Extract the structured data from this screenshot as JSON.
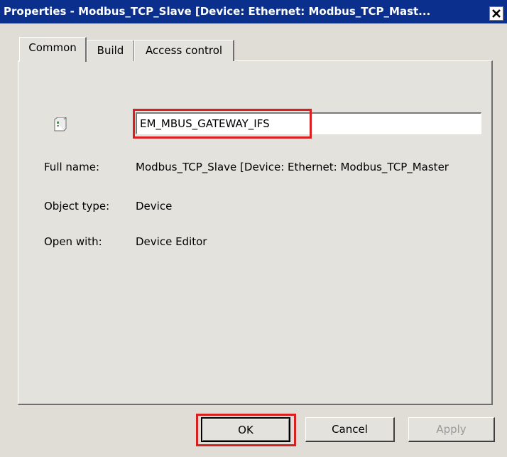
{
  "window": {
    "title": "Properties - Modbus_TCP_Slave [Device: Ethernet: Modbus_TCP_Mast...",
    "close_icon": "close-icon"
  },
  "tabs": [
    {
      "label": "Common",
      "active": true
    },
    {
      "label": "Build",
      "active": false
    },
    {
      "label": "Access control",
      "active": false
    }
  ],
  "common": {
    "device_icon": "device-icon",
    "name_value": "EM_MBUS_GATEWAY_IFS",
    "fields": [
      {
        "label": "Full name:",
        "value": "Modbus_TCP_Slave [Device: Ethernet: Modbus_TCP_Master"
      },
      {
        "label": "Object type:",
        "value": "Device"
      },
      {
        "label": "Open with:",
        "value": "Device Editor"
      }
    ]
  },
  "buttons": {
    "ok": "OK",
    "cancel": "Cancel",
    "apply": "Apply"
  },
  "colors": {
    "titlebar": "#0b2f8c",
    "highlight": "#d82020",
    "window_bg": "#e0ddd7"
  }
}
